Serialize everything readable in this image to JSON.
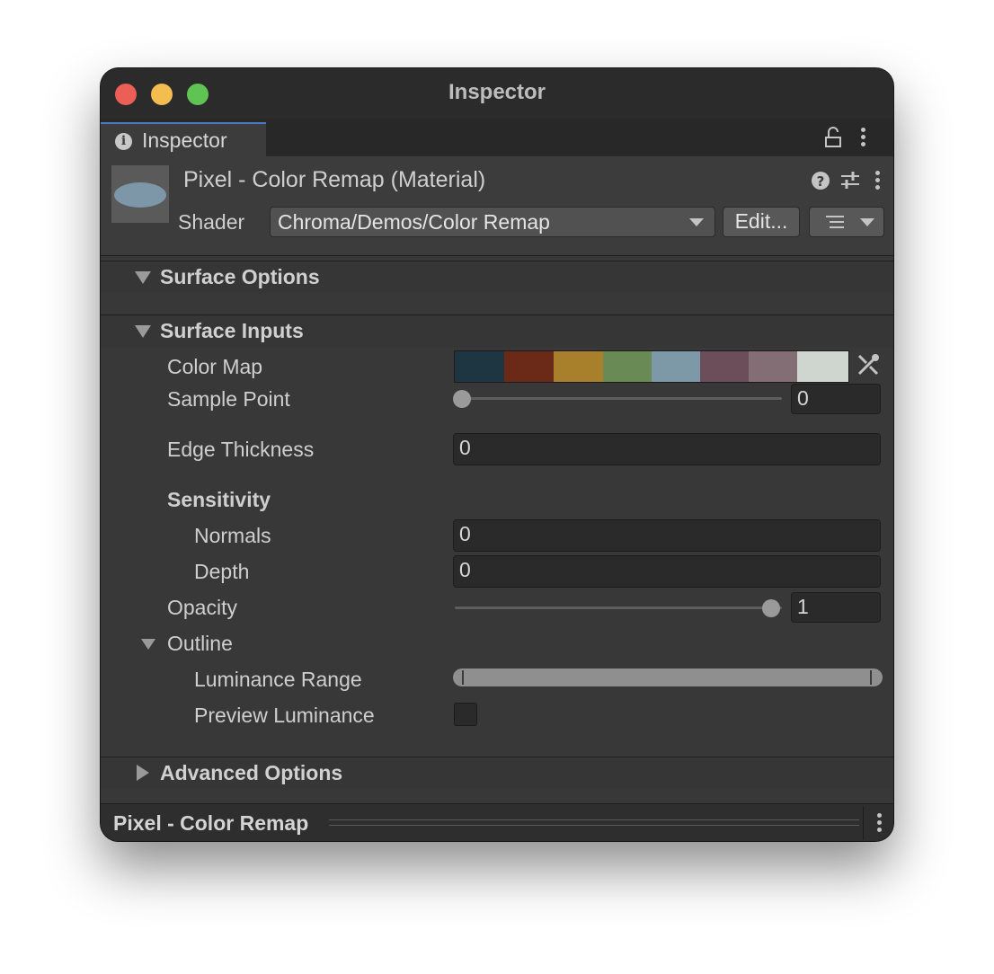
{
  "window": {
    "title": "Inspector"
  },
  "tab": {
    "label": "Inspector"
  },
  "material": {
    "name": "Pixel - Color Remap (Material)",
    "shader_label": "Shader",
    "shader_value": "Chroma/Demos/Color Remap",
    "edit_label": "Edit..."
  },
  "sections": {
    "surface_options": "Surface Options",
    "surface_inputs": "Surface Inputs",
    "advanced_options": "Advanced Options"
  },
  "properties": {
    "color_map": {
      "label": "Color Map",
      "colors": [
        "#1d3641",
        "#6b2a17",
        "#a87f2b",
        "#6a8a55",
        "#7d98a6",
        "#6b4e59",
        "#836e76",
        "#cfd6d0"
      ]
    },
    "sample_point": {
      "label": "Sample Point",
      "value": "0",
      "fraction": 0
    },
    "edge_thickness": {
      "label": "Edge Thickness",
      "value": "0"
    },
    "sensitivity": {
      "label": "Sensitivity"
    },
    "normals": {
      "label": "Normals",
      "value": "0"
    },
    "depth": {
      "label": "Depth",
      "value": "0"
    },
    "opacity": {
      "label": "Opacity",
      "value": "1",
      "fraction": 1
    },
    "outline": {
      "label": "Outline"
    },
    "luminance_range": {
      "label": "Luminance Range",
      "min": 0,
      "max": 1
    },
    "preview_luminance": {
      "label": "Preview Luminance",
      "checked": false
    }
  },
  "footer": {
    "label": "Pixel - Color Remap"
  },
  "icons": [
    "info-icon",
    "lock-icon",
    "more-options-icon",
    "help-icon",
    "preset-sliders-icon",
    "dropdown-caret-icon",
    "list-icon",
    "eyedropper-icon",
    "foldout-arrow-icon"
  ]
}
